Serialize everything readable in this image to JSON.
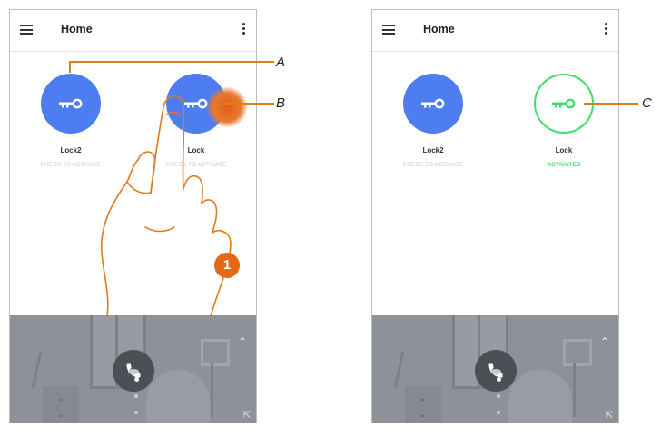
{
  "screens": [
    {
      "title": "Home",
      "locks": [
        {
          "name": "Lock2",
          "status": "PRESS TO ACTIVATE"
        },
        {
          "name": "Lock",
          "status": "PRESS TO ACTIVATE"
        }
      ]
    },
    {
      "title": "Home",
      "locks": [
        {
          "name": "Lock2",
          "status": "PRESS TO ACTIVATE"
        },
        {
          "name": "Lock",
          "status": "ACTIVATED"
        }
      ]
    }
  ],
  "callouts": {
    "a": "A",
    "b": "B",
    "c": "C"
  },
  "step_badge": "1",
  "colors": {
    "lock_blue": "#4d7df0",
    "activated_green": "#3dde6b",
    "callout_orange": "#e07a1a"
  },
  "icons": [
    "hamburger-menu-icon",
    "kebab-menu-icon",
    "key-icon",
    "phone-icon",
    "chevron-up-icon",
    "expand-icon",
    "tapping-hand"
  ]
}
